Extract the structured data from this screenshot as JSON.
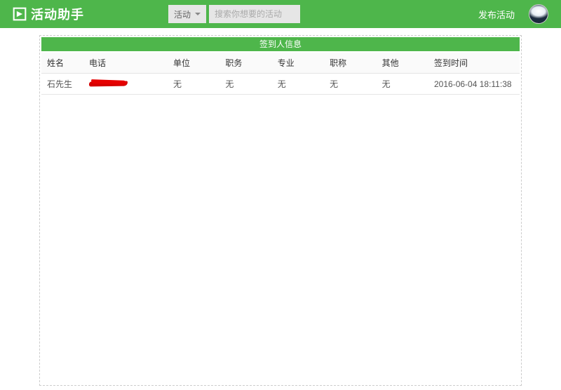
{
  "header": {
    "app_name": "活动助手",
    "search_category": "活动",
    "search_placeholder": "搜索你想要的活动",
    "publish_label": "发布活动"
  },
  "panel": {
    "title": "签到人信息"
  },
  "table": {
    "headers": {
      "name": "姓名",
      "phone": "电话",
      "org": "单位",
      "position": "职务",
      "major": "专业",
      "title": "职称",
      "other": "其他",
      "time": "签到时间"
    },
    "rows": [
      {
        "name": "石先生",
        "phone_redacted": true,
        "org": "无",
        "position": "无",
        "major": "无",
        "title": "无",
        "other": "无",
        "time": "2016-06-04 18:11:38"
      }
    ]
  }
}
